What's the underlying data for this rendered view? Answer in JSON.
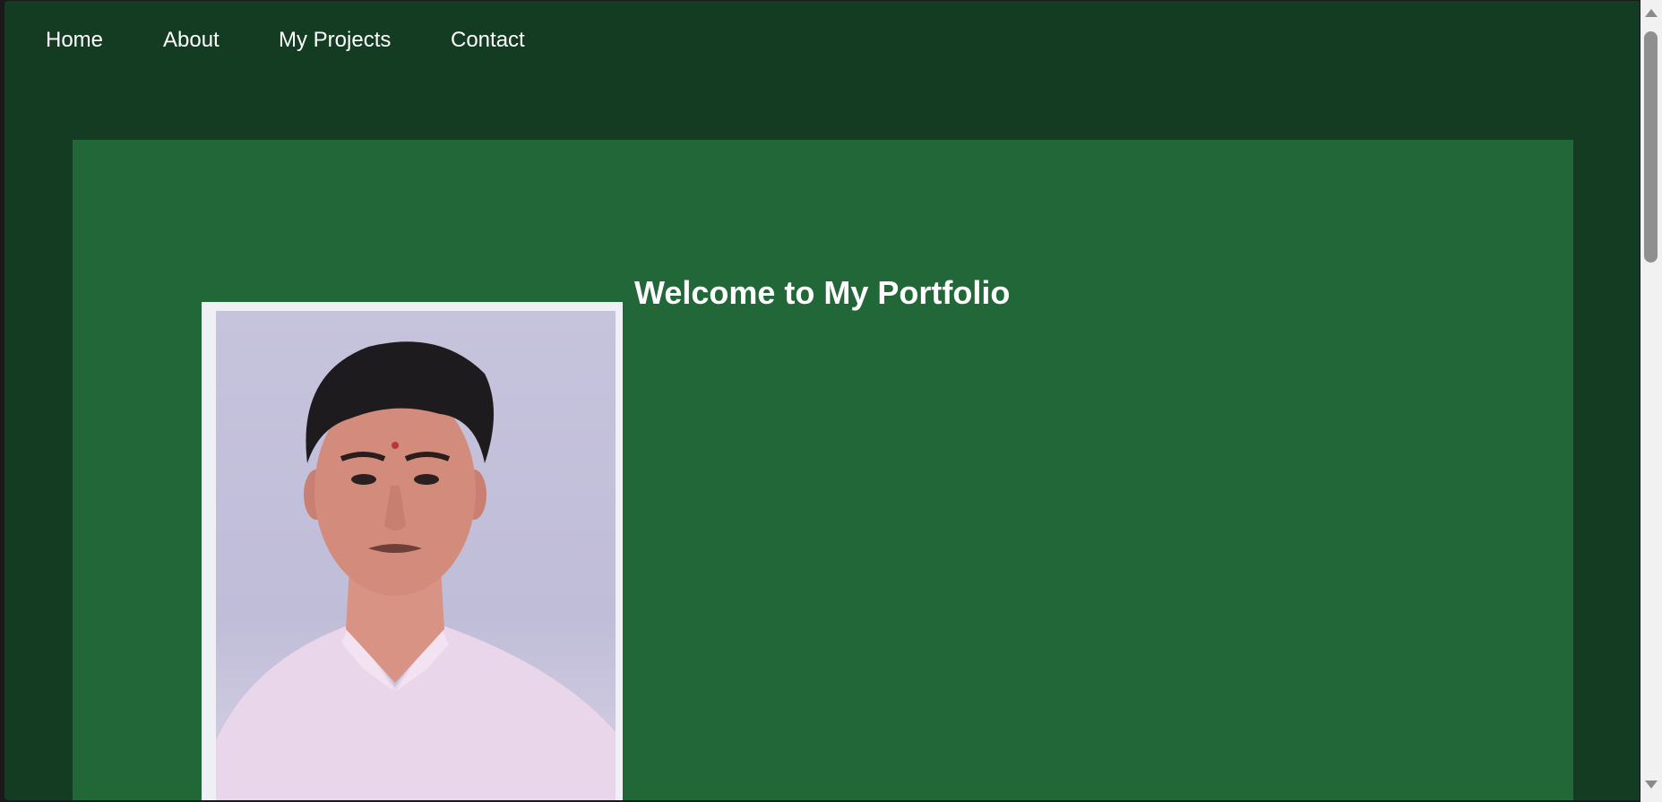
{
  "nav": {
    "items": [
      {
        "label": "Home"
      },
      {
        "label": "About"
      },
      {
        "label": "My Projects"
      },
      {
        "label": "Contact"
      }
    ]
  },
  "hero": {
    "title": "Welcome to My Portfolio"
  },
  "colors": {
    "page_background": "#133c22",
    "hero_background": "#216737",
    "text": "#ffffff"
  }
}
